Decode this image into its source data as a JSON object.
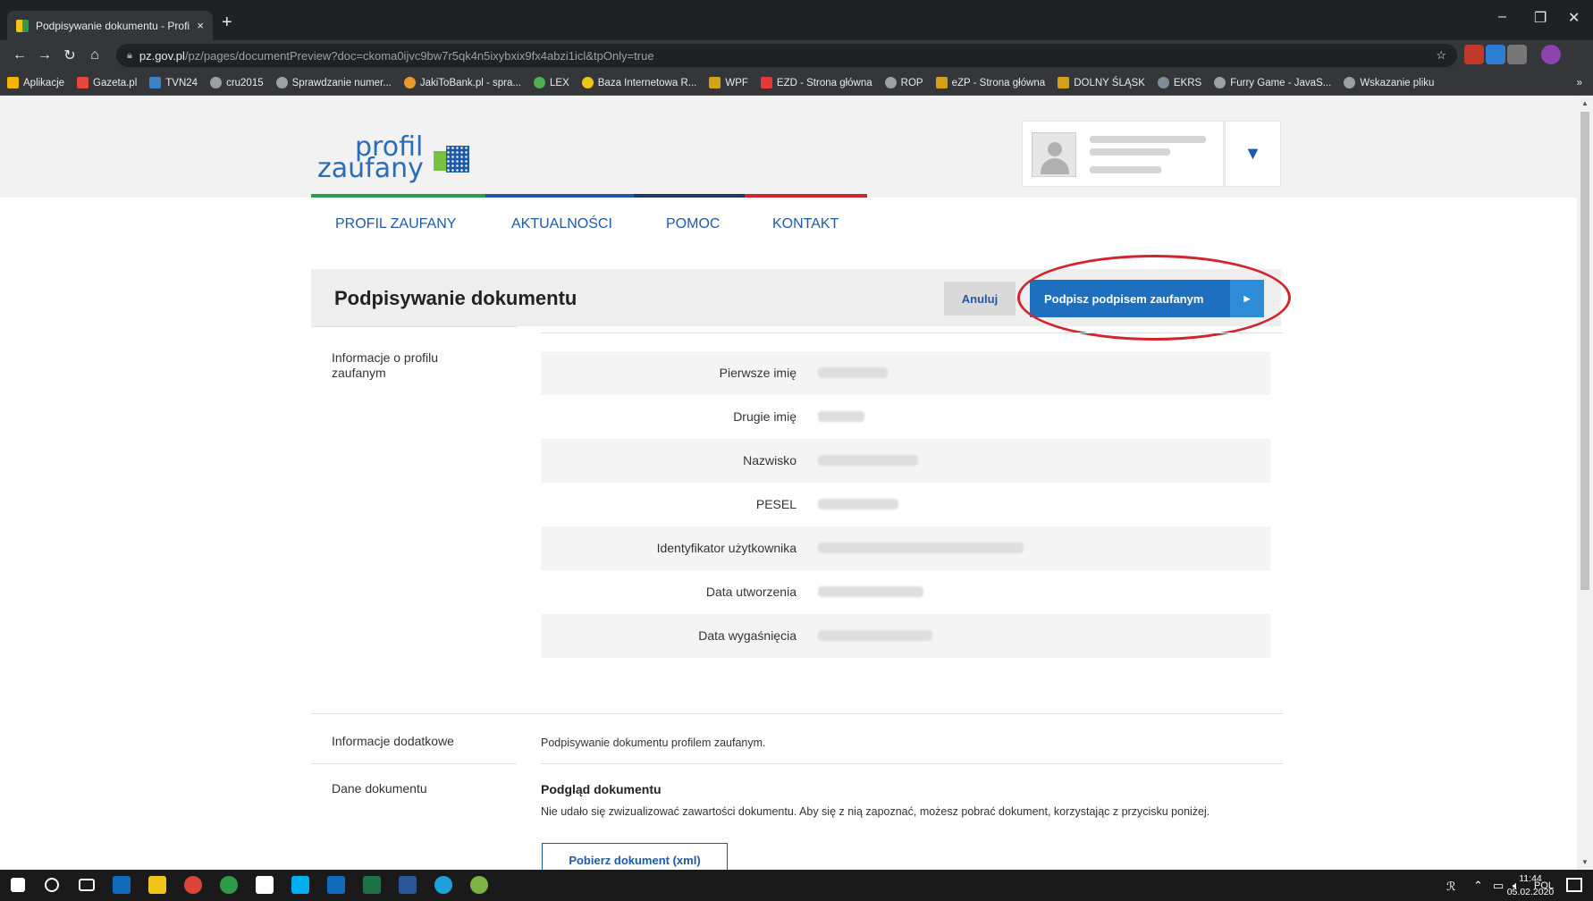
{
  "browser": {
    "tab_title": "Podpisywanie dokumentu - Profil",
    "tab_close": "×",
    "new_tab": "+",
    "url_host": "pz.gov.pl",
    "url_path": "/pz/pages/documentPreview?doc=ckoma0ijvc9bw7r5qk4n5ixybxix9fx4abzi1icl&tpOnly=true",
    "bookmarks": [
      "Aplikacje",
      "Gazeta.pl",
      "TVN24",
      "cru2015",
      "Sprawdzanie numer...",
      "JakiToBank.pl - spra...",
      "LEX",
      "Baza Internetowa R...",
      "WPF",
      "EZD - Strona główna",
      "ROP",
      "eZP - Strona główna",
      "DOLNY ŚLĄSK",
      "EKRS",
      "Furry Game - JavaS...",
      "Wskazanie pliku"
    ],
    "bookmarks_more": "»"
  },
  "header": {
    "logo_line1": "profil",
    "logo_line2": "zaufany"
  },
  "nav": [
    "PROFIL ZAUFANY",
    "AKTUALNOŚCI",
    "POMOC",
    "KONTAKT"
  ],
  "title_bar": {
    "title": "Podpisywanie dokumentu",
    "cancel_label": "Anuluj",
    "sign_label": "Podpisz podpisem zaufanym",
    "sign_arrow": "▶"
  },
  "profile_section": {
    "label": "Informacje o profilu zaufanym",
    "fields": [
      {
        "label": "Pierwsze imię"
      },
      {
        "label": "Drugie imię"
      },
      {
        "label": "Nazwisko"
      },
      {
        "label": "PESEL"
      },
      {
        "label": "Identyfikator użytkownika"
      },
      {
        "label": "Data utworzenia"
      },
      {
        "label": "Data wygaśnięcia"
      }
    ]
  },
  "additional": {
    "label": "Informacje dodatkowe",
    "text": "Podpisywanie dokumentu profilem zaufanym."
  },
  "document": {
    "label": "Dane dokumentu",
    "preview_heading": "Podgląd dokumentu",
    "message": "Nie udało się zwizualizować zawartości dokumentu. Aby się z nią zapoznać, możesz pobrać dokument, korzystając z przycisku poniżej.",
    "download_label": "Pobierz dokument (xml)"
  },
  "taskbar": {
    "lang": "POL",
    "time": "11:44",
    "date": "05.02.2020"
  },
  "colors": {
    "brand_blue": "#1f5aa6",
    "button_blue": "#1f6fbf",
    "annotation_red": "#d2242c"
  }
}
